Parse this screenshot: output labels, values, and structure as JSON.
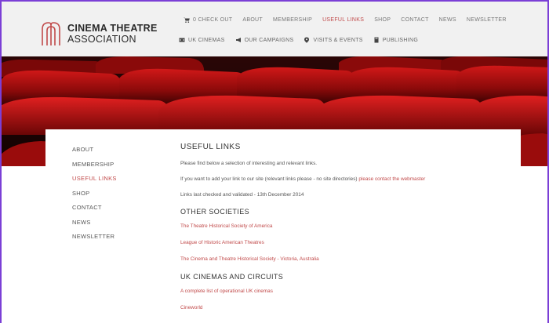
{
  "brand": {
    "line1": "CINEMA THEATRE",
    "line2": "ASSOCIATION"
  },
  "top_nav": {
    "checkout": "0  CHECK OUT",
    "items": [
      "ABOUT",
      "MEMBERSHIP",
      "USEFUL LINKS",
      "SHOP",
      "CONTACT",
      "NEWS",
      "NEWSLETTER"
    ],
    "active": "USEFUL LINKS"
  },
  "sub_nav": {
    "items": [
      {
        "label": "UK CINEMAS",
        "icon": "film-icon"
      },
      {
        "label": "OUR CAMPAIGNS",
        "icon": "megaphone-icon"
      },
      {
        "label": "VISITS & EVENTS",
        "icon": "location-icon"
      },
      {
        "label": "PUBLISHING",
        "icon": "book-icon"
      }
    ]
  },
  "sidebar": {
    "items": [
      "ABOUT",
      "MEMBERSHIP",
      "USEFUL LINKS",
      "SHOP",
      "CONTACT",
      "NEWS",
      "NEWSLETTER"
    ],
    "active": "USEFUL LINKS"
  },
  "content": {
    "title": "USEFUL LINKS",
    "intro": "Please find below a selection of interesting and relevant links.",
    "add_link_text": "If you want to add your link to our site (relevant links please - no site directories) ",
    "add_link_link": "please contact the webmaster",
    "checked": "Links last checked and validated - 13th December 2014",
    "sections": [
      {
        "heading": "OTHER SOCIETIES",
        "links": [
          "The Theatre Historical Society of America",
          "League of Historic American Theatres",
          "The Cinema and Theatre Historical Society - Victoria, Australia"
        ]
      },
      {
        "heading": "UK CINEMAS AND CIRCUITS",
        "links": [
          "A complete list of operational UK cinemas",
          "Cineworld"
        ]
      }
    ]
  },
  "colors": {
    "accent": "#c14a4a",
    "header_bg": "#f1f1f1",
    "frame": "#7b3fd6"
  }
}
